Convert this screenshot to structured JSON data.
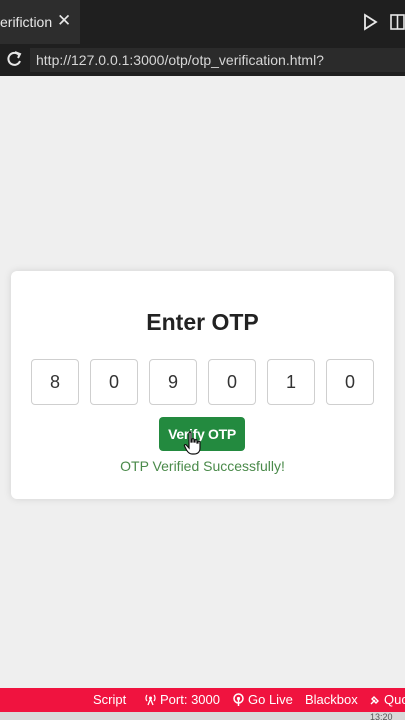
{
  "tab": {
    "title": "erifiction",
    "close_glyph": "✕"
  },
  "address": {
    "url": "http://127.0.0.1:3000/otp/otp_verification.html?"
  },
  "card": {
    "title": "Enter OTP",
    "digits": [
      "8",
      "0",
      "9",
      "0",
      "1",
      "0"
    ],
    "verify_label": "Verify OTP",
    "success_message": "OTP Verified Successfully!"
  },
  "statusbar": {
    "script": "Script",
    "port": "Port: 3000",
    "golive": "Go Live",
    "blackbox": "Blackbox",
    "quokka": "Quo"
  },
  "clock": "13:20",
  "colors": {
    "statusbar_bg": "#f0133f",
    "verify_bg": "#238a3f",
    "success_text": "#4a8a4a"
  },
  "icons": [
    "close-icon",
    "run-icon",
    "split-editor-icon",
    "reload-icon",
    "hand-cursor-icon",
    "broadcast-icon",
    "radio-icon",
    "quokka-icon"
  ]
}
